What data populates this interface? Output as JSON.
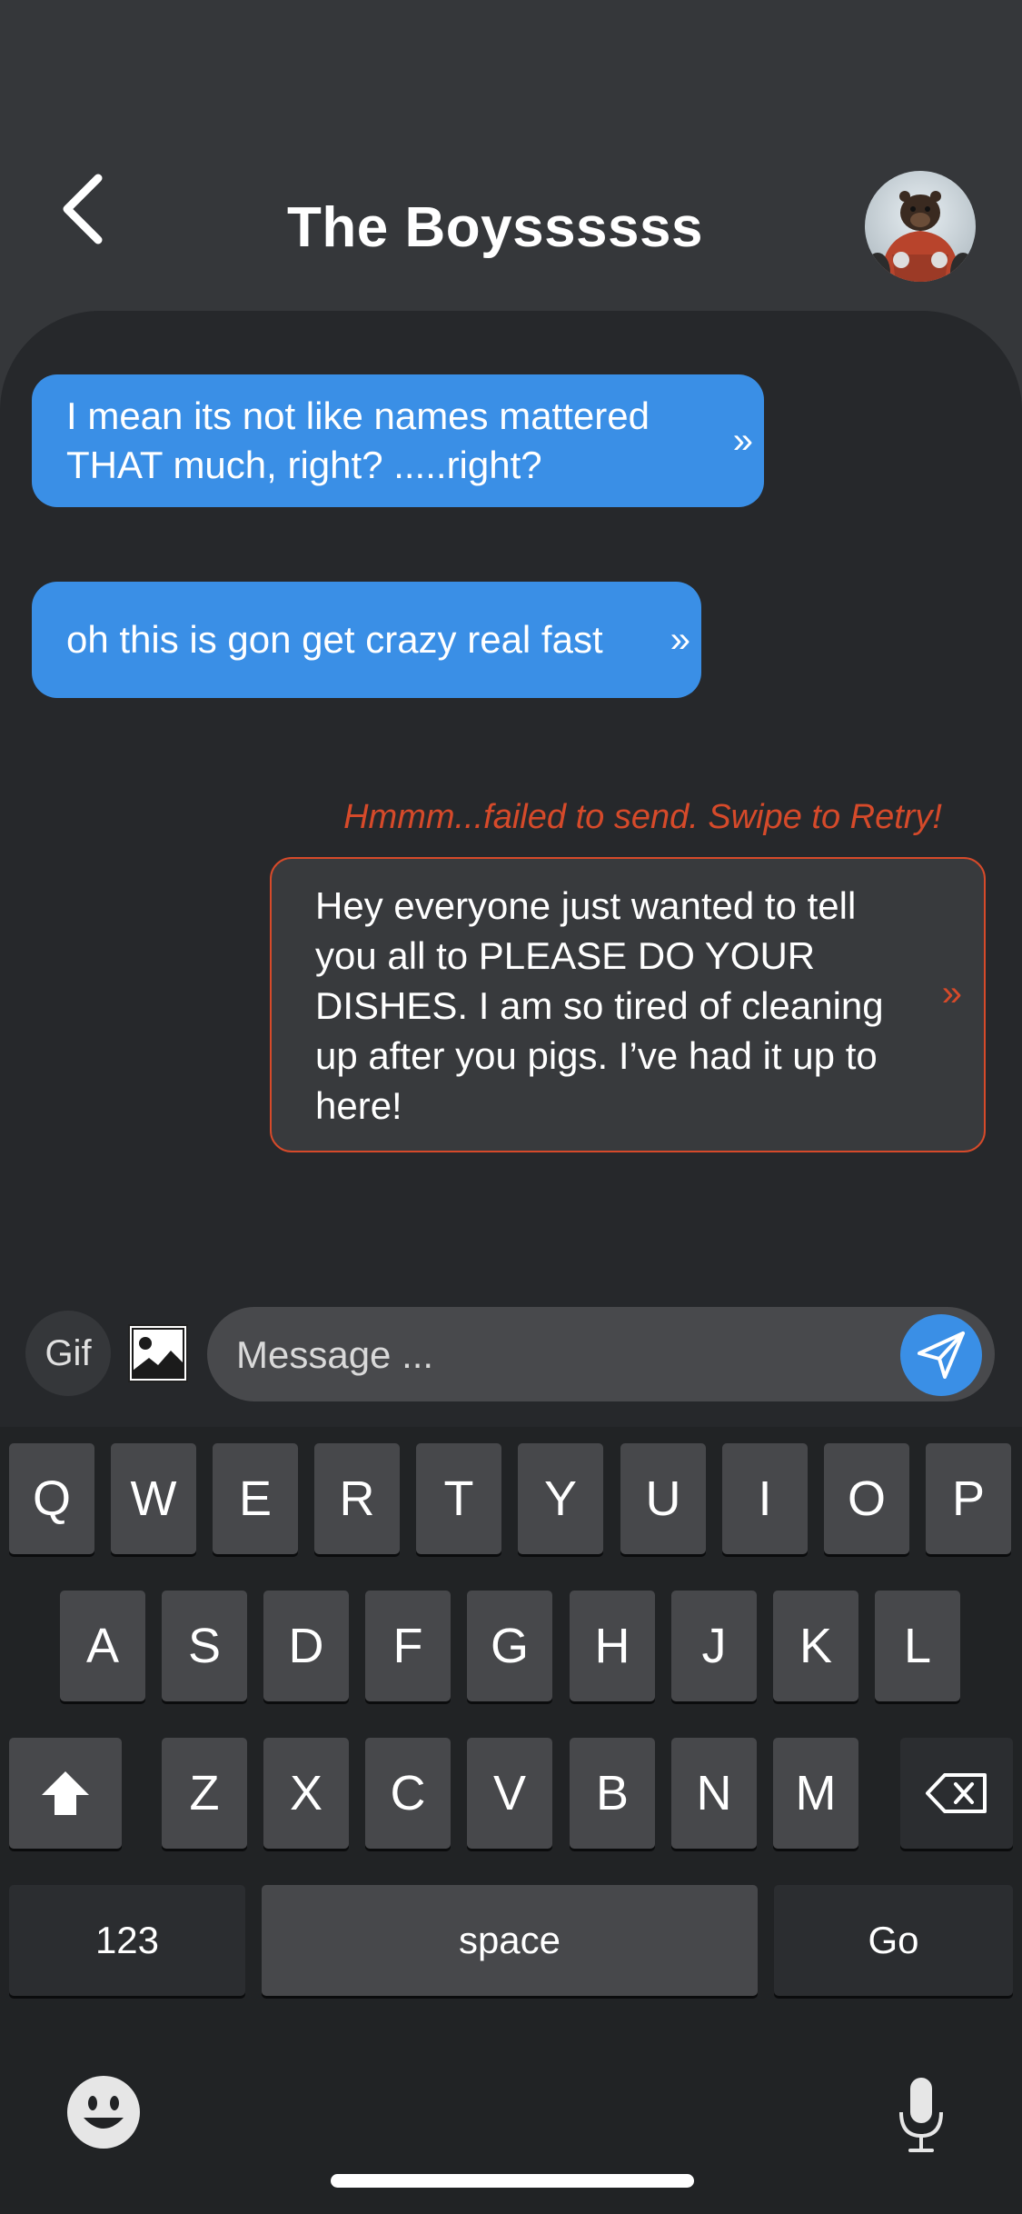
{
  "header": {
    "title": "The Boyssssss",
    "back_icon": "chevron-left-icon",
    "avatar": "group-avatar"
  },
  "messages": [
    {
      "direction": "incoming",
      "text": "I mean its not like names mattered THAT much, right? .....right?",
      "chevron": "»"
    },
    {
      "direction": "incoming",
      "text": "oh this is gon get crazy real fast",
      "chevron": "»"
    },
    {
      "direction": "outgoing",
      "status": "Hmmm...failed to send. Swipe to Retry!",
      "text": "Hey everyone just wanted to tell you all to PLEASE DO YOUR DISHES. I am so tired of cleaning up after you pigs. I’ve had it up to here!",
      "chevron": "»"
    }
  ],
  "composer": {
    "gif_label": "Gif",
    "image_icon": "image-icon",
    "placeholder": "Message ...",
    "send_icon": "send-icon"
  },
  "keyboard": {
    "row1": [
      "Q",
      "W",
      "E",
      "R",
      "T",
      "Y",
      "U",
      "I",
      "O",
      "P"
    ],
    "row2": [
      "A",
      "S",
      "D",
      "F",
      "G",
      "H",
      "J",
      "K",
      "L"
    ],
    "row3": [
      "Z",
      "X",
      "C",
      "V",
      "B",
      "N",
      "M"
    ],
    "shift_icon": "shift-icon",
    "backspace_icon": "backspace-icon",
    "numbers_label": "123",
    "space_label": "space",
    "go_label": "Go",
    "emoji_icon": "emoji-icon",
    "mic_icon": "microphone-icon"
  },
  "colors": {
    "accent": "#3a8fe6",
    "error": "#d64a2a",
    "background": "#26282b",
    "header": "#35373a"
  }
}
